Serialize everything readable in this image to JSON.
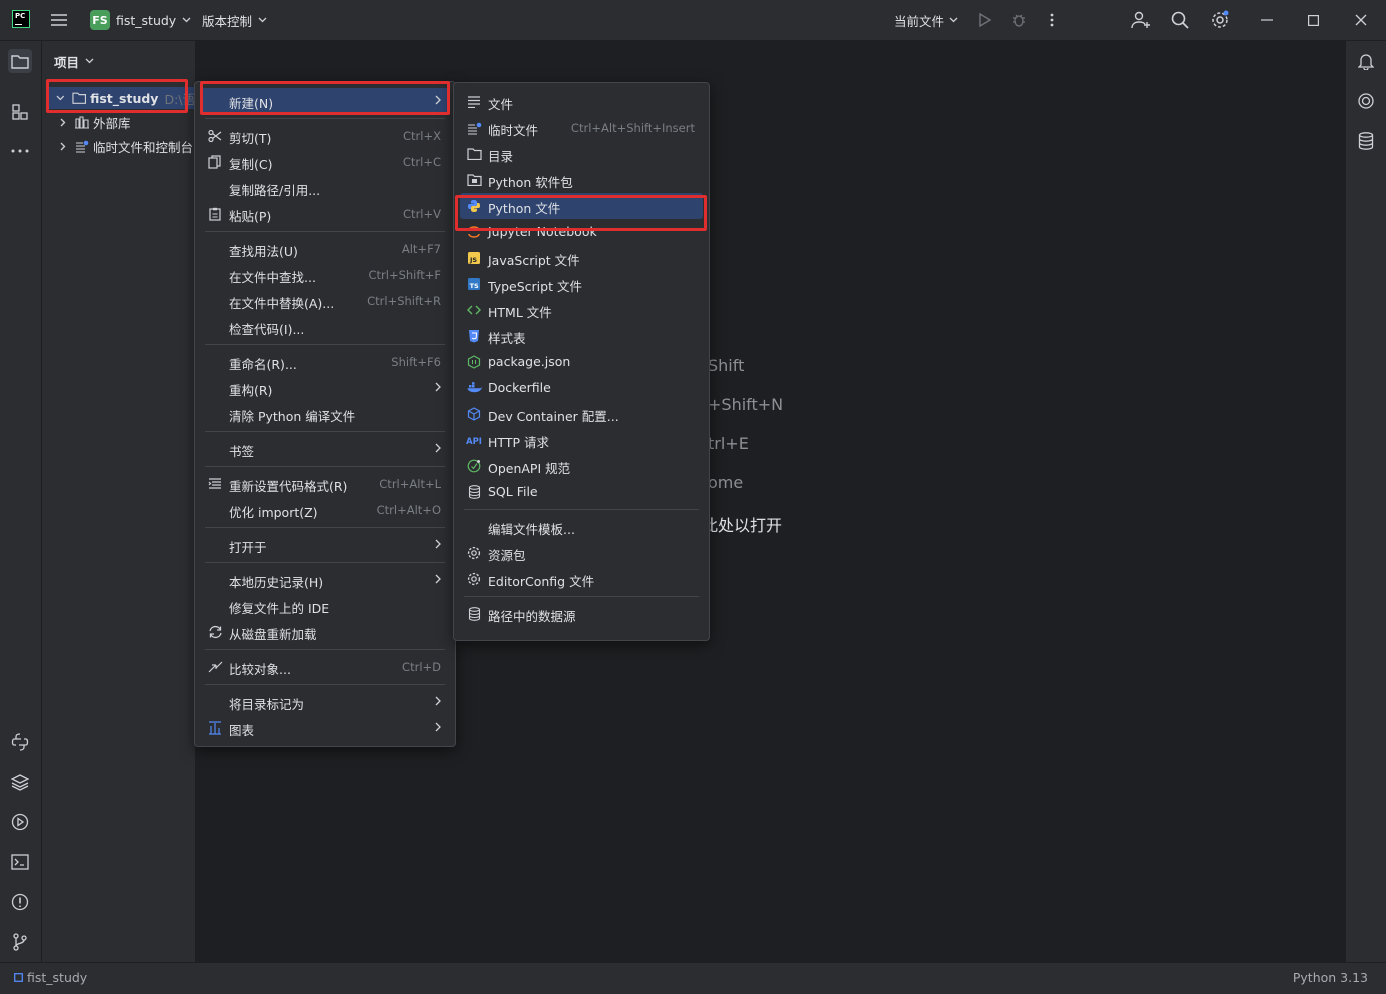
{
  "titlebar": {
    "app_logo_text": "PC",
    "project_badge": "FS",
    "project_name": "fist_study",
    "vcs_menu": "版本控制",
    "run_config": "当前文件"
  },
  "project_panel": {
    "title": "项目",
    "tree": [
      {
        "label": "fist_study",
        "path": "D:\\语"
      },
      {
        "label": "外部库"
      },
      {
        "label": "临时文件和控制台"
      }
    ]
  },
  "editor_hints": [
    "Shift",
    "+Shift+N",
    "trl+E",
    "ome",
    "此处以打开"
  ],
  "context_menu": [
    {
      "type": "item",
      "label": "新建(N)",
      "arrow": true,
      "selected": true
    },
    {
      "type": "sep"
    },
    {
      "type": "item",
      "label": "剪切(T)",
      "shortcut": "Ctrl+X",
      "icon": "scissors-icon"
    },
    {
      "type": "item",
      "label": "复制(C)",
      "shortcut": "Ctrl+C",
      "icon": "copy-icon"
    },
    {
      "type": "item",
      "label": "复制路径/引用..."
    },
    {
      "type": "item",
      "label": "粘贴(P)",
      "shortcut": "Ctrl+V",
      "icon": "paste-icon"
    },
    {
      "type": "sep"
    },
    {
      "type": "item",
      "label": "查找用法(U)",
      "shortcut": "Alt+F7"
    },
    {
      "type": "item",
      "label": "在文件中查找...",
      "shortcut": "Ctrl+Shift+F"
    },
    {
      "type": "item",
      "label": "在文件中替换(A)...",
      "shortcut": "Ctrl+Shift+R"
    },
    {
      "type": "item",
      "label": "检查代码(I)..."
    },
    {
      "type": "sep"
    },
    {
      "type": "item",
      "label": "重命名(R)...",
      "shortcut": "Shift+F6"
    },
    {
      "type": "item",
      "label": "重构(R)",
      "arrow": true
    },
    {
      "type": "item",
      "label": "清除 Python 编译文件"
    },
    {
      "type": "sep"
    },
    {
      "type": "item",
      "label": "书签",
      "arrow": true
    },
    {
      "type": "sep"
    },
    {
      "type": "item",
      "label": "重新设置代码格式(R)",
      "shortcut": "Ctrl+Alt+L",
      "icon": "reformat-icon"
    },
    {
      "type": "item",
      "label": "优化 import(Z)",
      "shortcut": "Ctrl+Alt+O"
    },
    {
      "type": "sep"
    },
    {
      "type": "item",
      "label": "打开于",
      "arrow": true
    },
    {
      "type": "sep"
    },
    {
      "type": "item",
      "label": "本地历史记录(H)",
      "arrow": true
    },
    {
      "type": "item",
      "label": "修复文件上的 IDE"
    },
    {
      "type": "item",
      "label": "从磁盘重新加载",
      "icon": "reload-icon"
    },
    {
      "type": "sep"
    },
    {
      "type": "item",
      "label": "比较对象...",
      "shortcut": "Ctrl+D",
      "icon": "compare-icon"
    },
    {
      "type": "sep"
    },
    {
      "type": "item",
      "label": "将目录标记为",
      "arrow": true
    },
    {
      "type": "item",
      "label": "图表",
      "arrow": true,
      "icon": "diagram-icon"
    }
  ],
  "submenu": [
    {
      "type": "item",
      "label": "文件",
      "icon": "file-icon"
    },
    {
      "type": "item",
      "label": "临时文件",
      "shortcut": "Ctrl+Alt+Shift+Insert",
      "icon": "scratch-file-icon"
    },
    {
      "type": "item",
      "label": "目录",
      "icon": "folder-icon"
    },
    {
      "type": "item",
      "label": "Python 软件包",
      "icon": "python-package-icon"
    },
    {
      "type": "item",
      "label": "Python 文件",
      "icon": "python-icon",
      "selected": true
    },
    {
      "type": "item",
      "label": "Jupyter Notebook",
      "icon": "jupyter-icon"
    },
    {
      "type": "item",
      "label": "JavaScript 文件",
      "icon": "javascript-icon"
    },
    {
      "type": "item",
      "label": "TypeScript 文件",
      "icon": "typescript-icon"
    },
    {
      "type": "item",
      "label": "HTML 文件",
      "icon": "html-icon"
    },
    {
      "type": "item",
      "label": "样式表",
      "icon": "css-icon"
    },
    {
      "type": "item",
      "label": "package.json",
      "icon": "nodejs-icon"
    },
    {
      "type": "item",
      "label": "Dockerfile",
      "icon": "docker-icon"
    },
    {
      "type": "item",
      "label": "Dev Container 配置...",
      "icon": "cube-icon"
    },
    {
      "type": "item",
      "label": "HTTP 请求",
      "icon": "api-icon"
    },
    {
      "type": "item",
      "label": "OpenAPI 规范",
      "icon": "openapi-icon"
    },
    {
      "type": "item",
      "label": "SQL File",
      "icon": "database-icon"
    },
    {
      "type": "sep"
    },
    {
      "type": "item",
      "label": "编辑文件模板..."
    },
    {
      "type": "item",
      "label": "资源包",
      "icon": "gear-icon"
    },
    {
      "type": "item",
      "label": "EditorConfig 文件",
      "icon": "gear-icon"
    },
    {
      "type": "sep"
    },
    {
      "type": "item",
      "label": "路径中的数据源",
      "icon": "database-icon"
    }
  ],
  "statusbar": {
    "project": "fist_study",
    "interpreter": "Python 3.13"
  },
  "colors": {
    "accent_selected": "#2e436e",
    "highlight_box": "#e02d2d"
  }
}
